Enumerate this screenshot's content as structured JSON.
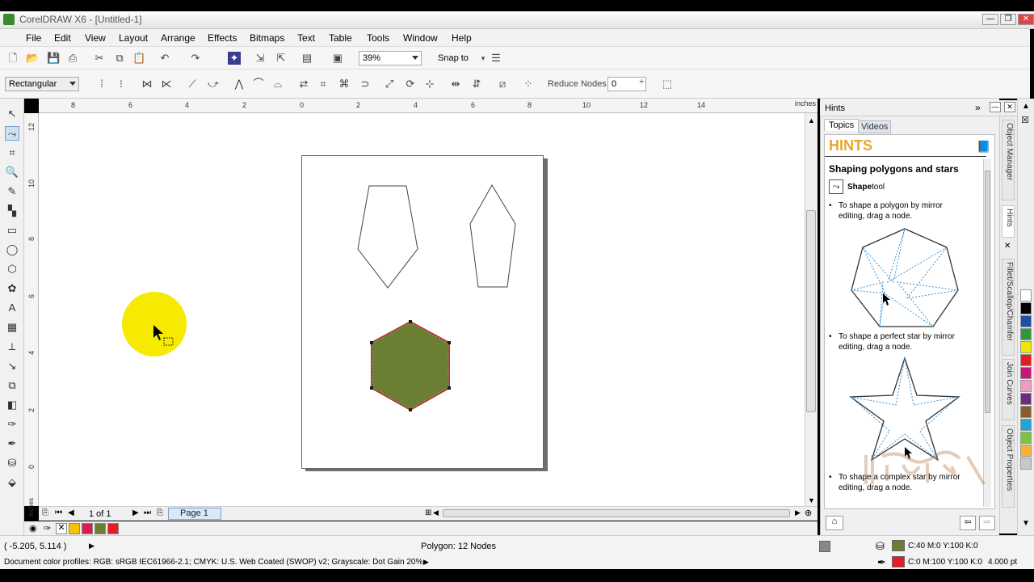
{
  "app": {
    "title": "CorelDRAW X6 - [Untitled-1]"
  },
  "menu": [
    "File",
    "Edit",
    "View",
    "Layout",
    "Arrange",
    "Effects",
    "Bitmaps",
    "Text",
    "Table",
    "Tools",
    "Window",
    "Help"
  ],
  "toolbar": {
    "zoom": "39%",
    "snap_to": "Snap to"
  },
  "property_bar": {
    "mode": "Rectangular",
    "reduce_nodes_label": "Reduce Nodes",
    "reduce_nodes_value": "0"
  },
  "rulers": {
    "h_ticks": [
      "8",
      "6",
      "4",
      "2",
      "0",
      "2",
      "4",
      "6",
      "8",
      "10",
      "12",
      "14"
    ],
    "h_unit": "inches",
    "v_ticks": [
      "12",
      "10",
      "8",
      "6",
      "4",
      "2",
      "0"
    ],
    "v_unit": "inches"
  },
  "page_nav": {
    "counter": "1 of 1",
    "page_tab": "Page 1"
  },
  "doc_palette": [
    "#f4c400",
    "#d91d4f",
    "#6b7f33",
    "#e81c24"
  ],
  "hints": {
    "panel_title": "Hints",
    "tab_topics": "Topics",
    "tab_videos": "Videos",
    "heading": "HINTS",
    "section_title": "Shaping polygons and stars",
    "tool_name": "Shape",
    "tool_suffix": " tool",
    "bullet1": "To shape a polygon by mirror editing, drag a node.",
    "bullet2": "To shape a perfect star by mirror editing, drag a node.",
    "bullet3": "To shape a complex star by mirror editing, drag a node."
  },
  "dock_tabs": [
    "Object Manager",
    "Hints",
    "Fillet/Scallop/Chamfer",
    "Join Curves",
    "Object Properties"
  ],
  "color_palette": [
    "#ffffff",
    "#000000",
    "#1f4fa5",
    "#2e9a3a",
    "#f2e600",
    "#e31d24",
    "#c7157a",
    "#f29ac0",
    "#6d2b82",
    "#8b5a2b",
    "#1aa7d6",
    "#7fc241",
    "#fbb034",
    "#c8c8c8"
  ],
  "status": {
    "coords": "( -5.205, 5.114 )",
    "object_info": "Polygon: 12 Nodes",
    "profiles": "Document color profiles: RGB: sRGB IEC61966-2.1; CMYK: U.S. Web Coated (SWOP) v2; Grayscale: Dot Gain 20%",
    "fill_info": "C:40 M:0 Y:100 K:0",
    "fill_color": "#6b7f33",
    "outline_info": "C:0 M:100 Y:100 K:0",
    "outline_width": "4.000 pt",
    "outline_color": "#e81c24"
  },
  "canvas": {
    "hexagon_fill": "#6b7f33",
    "hexagon_outline": "#b33a2a",
    "cursor_highlight": "#f5ea00"
  }
}
